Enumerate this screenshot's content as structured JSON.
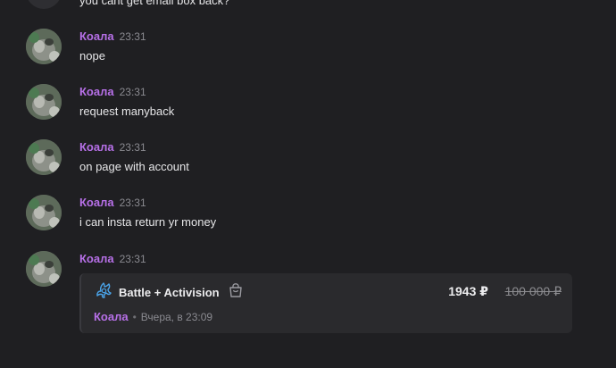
{
  "messages": {
    "partial_top_text": "you cant get email box back?",
    "items": [
      {
        "author": "Коала",
        "time": "23:31",
        "text": "nope"
      },
      {
        "author": "Коала",
        "time": "23:31",
        "text": "request manyback"
      },
      {
        "author": "Коала",
        "time": "23:31",
        "text": "on page with account"
      },
      {
        "author": "Коала",
        "time": "23:31",
        "text": "i can insta return yr money"
      },
      {
        "author": "Коала",
        "time": "23:31"
      }
    ]
  },
  "order_card": {
    "product_icon": "battlenet-logo-icon",
    "title": "Battle + Activision",
    "cart_icon": "shopping-bag-icon",
    "price": "1943 ₽",
    "old_price": "100 000 ₽",
    "seller": "Коала",
    "separator": "•",
    "date": "Вчера, в 23:09"
  },
  "colors": {
    "background": "#1f1f22",
    "author": "#b770e8",
    "card_background": "#2a2a2d",
    "text": "#e6e6e8",
    "muted": "#8a8a90",
    "brand_icon": "#4aa3e8"
  }
}
